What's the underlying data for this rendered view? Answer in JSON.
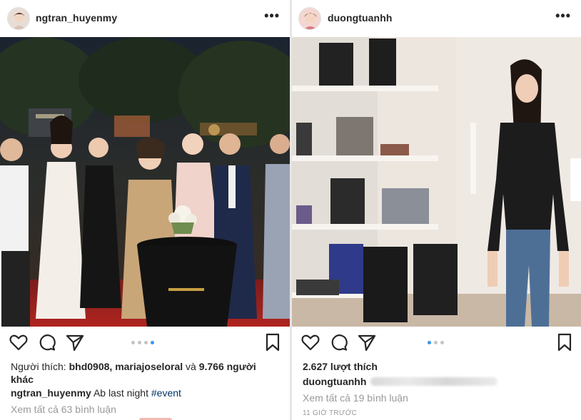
{
  "left_post": {
    "username": "ngtran_huyenmy",
    "more_label": "•••",
    "carousel": {
      "count": 4,
      "active_index": 3
    },
    "likes": {
      "prefix": "Người thích:",
      "user1": "bhd0908",
      "sep": ",",
      "user2": "mariajoseloral",
      "conj": "và",
      "others": "9.766 người khác"
    },
    "caption": {
      "user": "ngtran_huyenmy",
      "text": "Ab last night",
      "hashtag": "#event"
    },
    "view_comments": "Xem tất cả 63 bình luận"
  },
  "right_post": {
    "username": "duongtuanhh",
    "more_label": "•••",
    "carousel": {
      "count": 3,
      "active_index": 0
    },
    "likes_text": "2.627 lượt thích",
    "caption_user": "duongtuanhh",
    "view_comments": "Xem tất cả 19 bình luận",
    "timestamp": "11 GIỜ TRƯỚC"
  },
  "colors": {
    "link_blue": "#003569",
    "active_dot": "#3897f0",
    "muted": "#999999",
    "text": "#262626"
  },
  "icons": [
    "heart-icon",
    "comment-icon",
    "share-icon",
    "bookmark-icon",
    "more-icon"
  ]
}
